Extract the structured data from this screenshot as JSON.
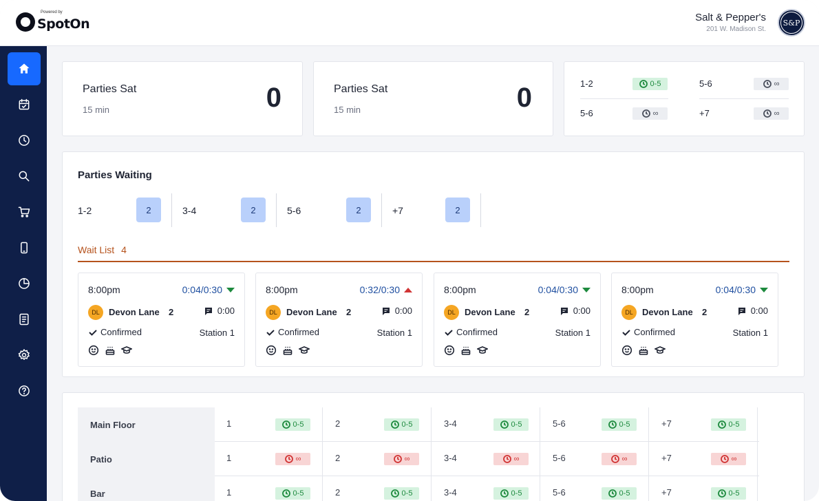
{
  "header": {
    "logo_powered": "Powered by",
    "logo_text": "SpotOn",
    "restaurant_name": "Salt & Pepper's",
    "restaurant_address": "201 W. Madison St.",
    "avatar_initials": "S&P"
  },
  "sidebar": {
    "items": [
      {
        "icon": "home-icon",
        "active": true
      },
      {
        "icon": "calendar-icon",
        "active": false
      },
      {
        "icon": "clock-icon",
        "active": false
      },
      {
        "icon": "search-icon",
        "active": false
      },
      {
        "icon": "cart-icon",
        "active": false
      },
      {
        "icon": "phone-icon",
        "active": false
      },
      {
        "icon": "pie-chart-icon",
        "active": false
      },
      {
        "icon": "document-icon",
        "active": false
      },
      {
        "icon": "gear-icon",
        "active": false
      },
      {
        "icon": "help-icon",
        "active": false
      }
    ]
  },
  "stats": [
    {
      "title": "Parties Sat",
      "subtitle": "15 min",
      "value": "0"
    },
    {
      "title": "Parties Sat",
      "subtitle": "15 min",
      "value": "0"
    }
  ],
  "wait_summary": [
    {
      "label": "1-2",
      "chip": "0-5",
      "status": "green"
    },
    {
      "label": "5-6",
      "chip": "∞",
      "status": "grey"
    },
    {
      "label": "5-6",
      "chip": "∞",
      "status": "grey"
    },
    {
      "label": "+7",
      "chip": "∞",
      "status": "grey"
    }
  ],
  "parties_waiting": {
    "title": "Parties Waiting",
    "groups": [
      {
        "label": "1-2",
        "count": "2"
      },
      {
        "label": "3-4",
        "count": "2"
      },
      {
        "label": "5-6",
        "count": "2"
      },
      {
        "label": "+7",
        "count": "2"
      }
    ]
  },
  "wait_list": {
    "title": "Wait List",
    "count": "4",
    "entries": [
      {
        "time": "8:00pm",
        "elapsed": "0:04/0:30",
        "trend": "down",
        "initials": "DL",
        "name": "Devon Lane",
        "party_size": "2",
        "message_time": "0:00",
        "status": "Confirmed",
        "station": "Station 1"
      },
      {
        "time": "8:00pm",
        "elapsed": "0:32/0:30",
        "trend": "up",
        "initials": "DL",
        "name": "Devon Lane",
        "party_size": "2",
        "message_time": "0:00",
        "status": "Confirmed",
        "station": "Station 1"
      },
      {
        "time": "8:00pm",
        "elapsed": "0:04/0:30",
        "trend": "down",
        "initials": "DL",
        "name": "Devon Lane",
        "party_size": "2",
        "message_time": "0:00",
        "status": "Confirmed",
        "station": "Station 1"
      },
      {
        "time": "8:00pm",
        "elapsed": "0:04/0:30",
        "trend": "down",
        "initials": "DL",
        "name": "Devon Lane",
        "party_size": "2",
        "message_time": "0:00",
        "status": "Confirmed",
        "station": "Station 1"
      }
    ]
  },
  "sections_table": {
    "rows": [
      {
        "name": "Main Floor",
        "cells": [
          {
            "label": "1",
            "chip": "0-5",
            "status": "green"
          },
          {
            "label": "2",
            "chip": "0-5",
            "status": "green"
          },
          {
            "label": "3-4",
            "chip": "0-5",
            "status": "green"
          },
          {
            "label": "5-6",
            "chip": "0-5",
            "status": "green"
          },
          {
            "label": "+7",
            "chip": "0-5",
            "status": "green"
          }
        ]
      },
      {
        "name": "Patio",
        "cells": [
          {
            "label": "1",
            "chip": "∞",
            "status": "red"
          },
          {
            "label": "2",
            "chip": "∞",
            "status": "red"
          },
          {
            "label": "3-4",
            "chip": "∞",
            "status": "red"
          },
          {
            "label": "5-6",
            "chip": "∞",
            "status": "red"
          },
          {
            "label": "+7",
            "chip": "∞",
            "status": "red"
          }
        ]
      },
      {
        "name": "Bar",
        "cells": [
          {
            "label": "1",
            "chip": "0-5",
            "status": "green"
          },
          {
            "label": "2",
            "chip": "0-5",
            "status": "green"
          },
          {
            "label": "3-4",
            "chip": "0-5",
            "status": "green"
          },
          {
            "label": "5-6",
            "chip": "0-5",
            "status": "green"
          },
          {
            "label": "+7",
            "chip": "0-5",
            "status": "green"
          }
        ]
      }
    ]
  },
  "colors": {
    "sidebar_bg": "#0f1f48",
    "active_nav": "#1769ff",
    "accent_orange": "#b5521c",
    "status_green": "#1d8a3e",
    "status_red": "#d13434",
    "count_badge": "#b9d0fb"
  }
}
